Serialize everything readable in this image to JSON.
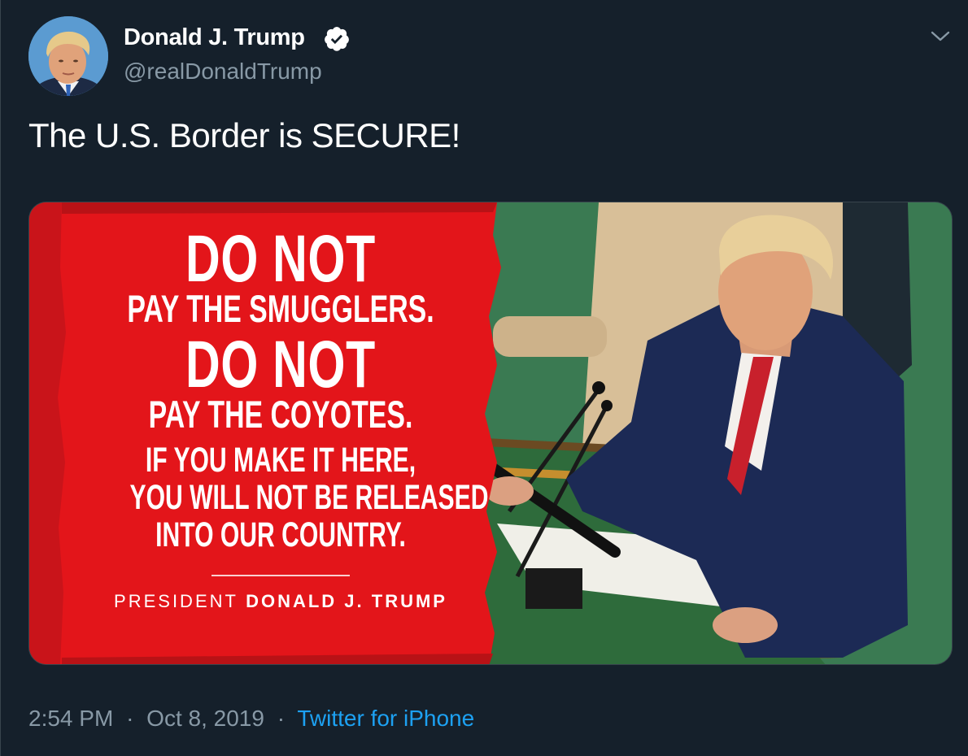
{
  "tweet": {
    "author": {
      "display_name": "Donald J. Trump",
      "handle": "@realDonaldTrump",
      "verified": true,
      "avatar_icon": "profile-photo"
    },
    "text": "The U.S. Border is SECURE!",
    "menu_icon": "chevron-down-icon",
    "media": {
      "poster_lines": {
        "line1": "DO NOT",
        "line2": "PAY THE SMUGGLERS.",
        "line3": "DO NOT",
        "line4": "PAY THE COYOTES.",
        "line5": "IF YOU MAKE IT HERE,",
        "line6": "YOU WILL NOT BE RELEASED",
        "line7": "INTO OUR COUNTRY.",
        "signature_prefix": "PRESIDENT",
        "signature_name": "DONALD J. TRUMP"
      },
      "poster_color": "#e3151a"
    },
    "meta": {
      "time": "2:54 PM",
      "separator": "·",
      "date": "Oct 8, 2019",
      "source": "Twitter for iPhone"
    }
  },
  "colors": {
    "background": "#15202b",
    "primary_text": "#ffffff",
    "secondary_text": "#8899a6",
    "link": "#1da1f2",
    "verified_badge": "#ffffff"
  }
}
